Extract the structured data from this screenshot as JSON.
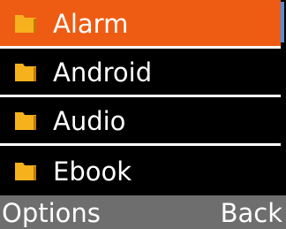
{
  "colors": {
    "selection": "#ee5c13",
    "folder_icon": "#f6b21c",
    "softkey_bar": "#6e6e6e",
    "scrollbar_thumb": "#5b8bd6"
  },
  "list": {
    "items": [
      {
        "label": "Alarm",
        "icon": "folder-icon",
        "selected": true
      },
      {
        "label": "Android",
        "icon": "folder-icon",
        "selected": false
      },
      {
        "label": "Audio",
        "icon": "folder-icon",
        "selected": false
      },
      {
        "label": "Ebook",
        "icon": "folder-icon",
        "selected": false
      }
    ]
  },
  "softkeys": {
    "left": "Options",
    "right": "Back"
  }
}
